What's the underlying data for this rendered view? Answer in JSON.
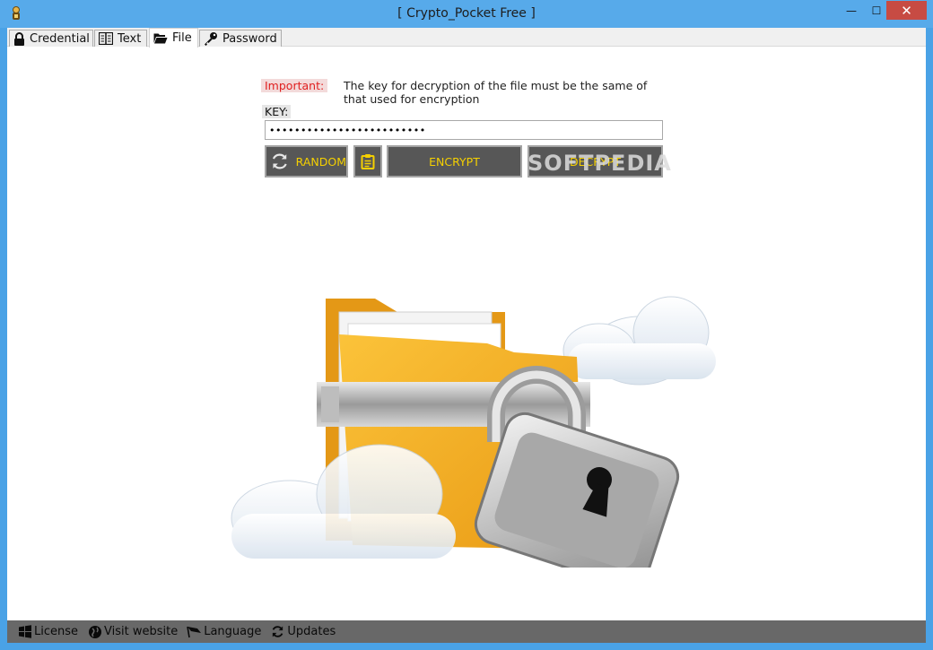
{
  "window": {
    "title": "[ Crypto_Pocket Free ]",
    "minimize_glyph": "—",
    "maximize_glyph": "☐",
    "close_glyph": "✕"
  },
  "tabs": [
    {
      "label": "Credential",
      "icon": "lock-icon",
      "active": false
    },
    {
      "label": "Text",
      "icon": "book-icon",
      "active": false
    },
    {
      "label": "File",
      "icon": "folder-open-icon",
      "active": true
    },
    {
      "label": "Password",
      "icon": "key-icon",
      "active": false
    }
  ],
  "file_panel": {
    "important_label": "Important:",
    "important_text": "The key for decryption of the file must be the same of that used for encryption",
    "key_label": "KEY:",
    "key_value": "•••••••••••••••••••••••••",
    "buttons": {
      "random": "RANDOM",
      "encrypt": "ENCRYPT",
      "decrypt": "DECRYPT"
    },
    "watermark": "SOFTPEDIA"
  },
  "statusbar": {
    "items": [
      {
        "label": "License",
        "icon": "windows-icon"
      },
      {
        "label": "Visit website",
        "icon": "globe-icon"
      },
      {
        "label": "Language",
        "icon": "flag-icon"
      },
      {
        "label": "Updates",
        "icon": "refresh-icon"
      }
    ]
  },
  "colors": {
    "titlebar": "#57aaea",
    "close_button": "#c74b43",
    "button_bg": "#575757",
    "button_text": "#f5d000",
    "important_text": "#e02020",
    "statusbar": "#686868"
  }
}
